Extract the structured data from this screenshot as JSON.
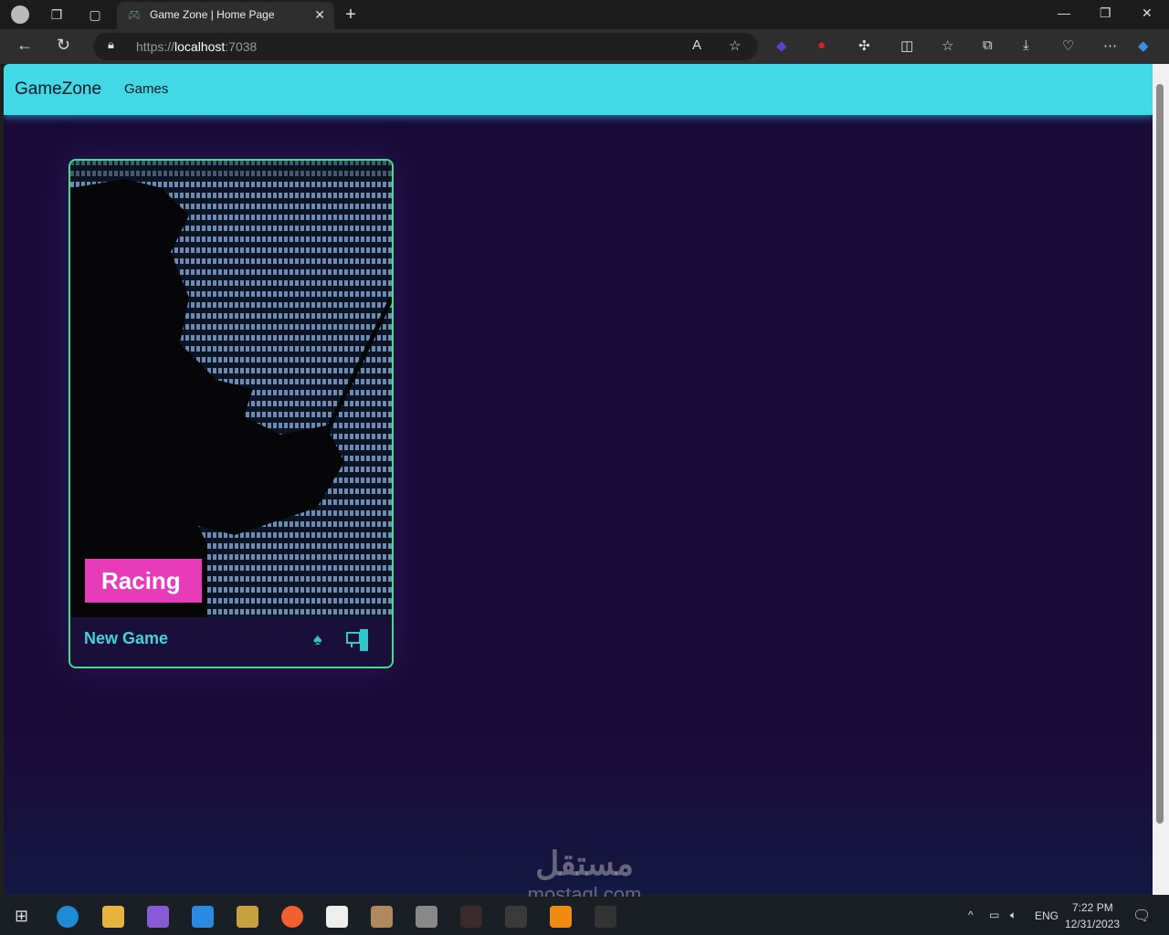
{
  "browser": {
    "tab_title": "Game Zone | Home Page",
    "url_scheme": "https://",
    "url_host": "localhost",
    "url_port": ":7038"
  },
  "site": {
    "brand": "GameZone",
    "nav": [
      {
        "label": "Games"
      }
    ]
  },
  "games": [
    {
      "category": "Racing",
      "name": "New Game",
      "platforms": [
        "playstation",
        "pc"
      ]
    }
  ],
  "taskbar": {
    "time": "7:22 PM",
    "date": "12/31/2023",
    "lang": "ENG"
  },
  "watermark": {
    "arabic": "مستقل",
    "latin": "mostaql.com"
  }
}
